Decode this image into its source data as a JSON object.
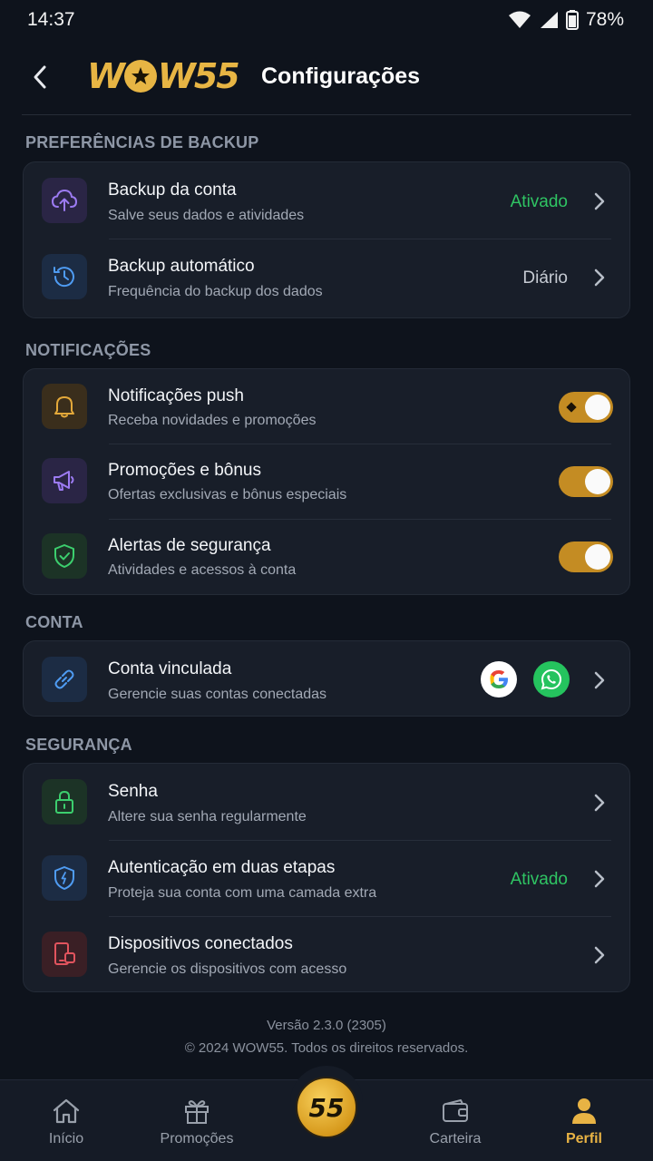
{
  "status": {
    "time": "14:37",
    "battery": "78%"
  },
  "header": {
    "logo": "WOW55",
    "logo_left": "W",
    "logo_right": "W55",
    "title": "Configurações"
  },
  "sections": {
    "backup": {
      "title": "PREFERÊNCIAS DE BACKUP",
      "items": [
        {
          "title": "Backup da conta",
          "subtitle": "Salve seus dados e atividades",
          "value": "Ativado"
        },
        {
          "title": "Backup automático",
          "subtitle": "Frequência do backup dos dados",
          "value": "Diário"
        }
      ]
    },
    "notifications": {
      "title": "NOTIFICAÇÕES",
      "items": [
        {
          "title": "Notificações push",
          "subtitle": "Receba novidades e promoções",
          "enabled": true
        },
        {
          "title": "Promoções e bônus",
          "subtitle": "Ofertas exclusivas e bônus especiais",
          "enabled": true
        },
        {
          "title": "Alertas de segurança",
          "subtitle": "Atividades e acessos à conta",
          "enabled": true
        }
      ]
    },
    "account": {
      "title": "CONTA",
      "items": [
        {
          "title": "Conta vinculada",
          "subtitle": "Gerencie suas contas conectadas",
          "linked": [
            "google-icon",
            "whatsapp-icon"
          ]
        }
      ]
    },
    "security": {
      "title": "SEGURANÇA",
      "items": [
        {
          "title": "Senha",
          "subtitle": "Altere sua senha regularmente"
        },
        {
          "title": "Autenticação em duas etapas",
          "subtitle": "Proteja sua conta com uma camada extra",
          "value": "Ativado"
        },
        {
          "title": "Dispositivos conectados",
          "subtitle": "Gerencie os dispositivos com acesso"
        }
      ]
    }
  },
  "footer": {
    "version": "Versão 2.3.0 (2305)",
    "copyright": "© 2024 WOW55. Todos os direitos reservados."
  },
  "nav": {
    "items": [
      {
        "label": "Início"
      },
      {
        "label": "Promoções"
      },
      {
        "label": "55"
      },
      {
        "label": "Carteira"
      },
      {
        "label": "Perfil",
        "active": true
      }
    ]
  },
  "colors": {
    "background": "#0e131c",
    "card": "#181e29",
    "accent_gold": "#e7b544",
    "status_green": "#2fc463",
    "toggle_on": "#c48c23"
  }
}
